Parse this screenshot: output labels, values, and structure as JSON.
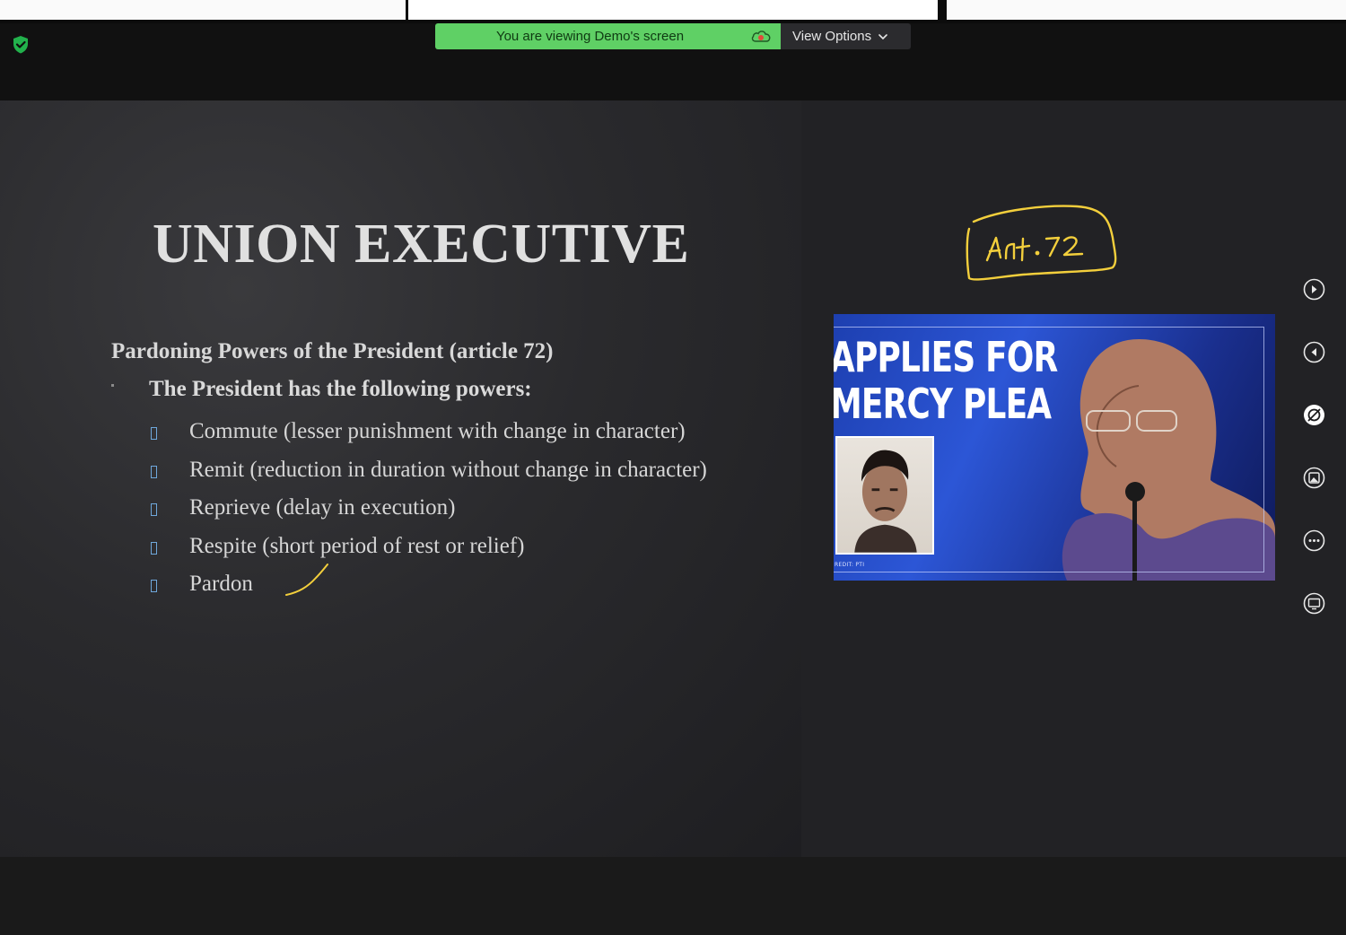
{
  "topbar": {
    "sharing_notice": "You are viewing Demo's screen",
    "view_options_label": "View Options"
  },
  "slide": {
    "title": "UNION EXECUTIVE",
    "subheading": "Pardoning Powers of the President (article 72)",
    "lead": "The President has the following powers:",
    "bullets": [
      "Commute (lesser punishment with change in character)",
      "Remit (reduction in duration without change in character)",
      "Reprieve (delay in execution)",
      "Respite (short period of rest or relief)",
      "Pardon"
    ]
  },
  "annotation": {
    "handwritten_note": "Art.72",
    "ink_color": "#f3cf3c"
  },
  "news_image": {
    "headline_line1": "APPLIES FOR",
    "headline_line2": "MERCY PLEA",
    "credit": "REDIT: PTI"
  },
  "tools": [
    {
      "icon": "play-next-icon"
    },
    {
      "icon": "play-previous-icon"
    },
    {
      "icon": "annotate-off-icon"
    },
    {
      "icon": "picture-icon"
    },
    {
      "icon": "more-icon"
    },
    {
      "icon": "screen-share-icon"
    }
  ],
  "colors": {
    "sharing_banner": "#5fd065",
    "bullet_marker": "#6fa8dc"
  }
}
